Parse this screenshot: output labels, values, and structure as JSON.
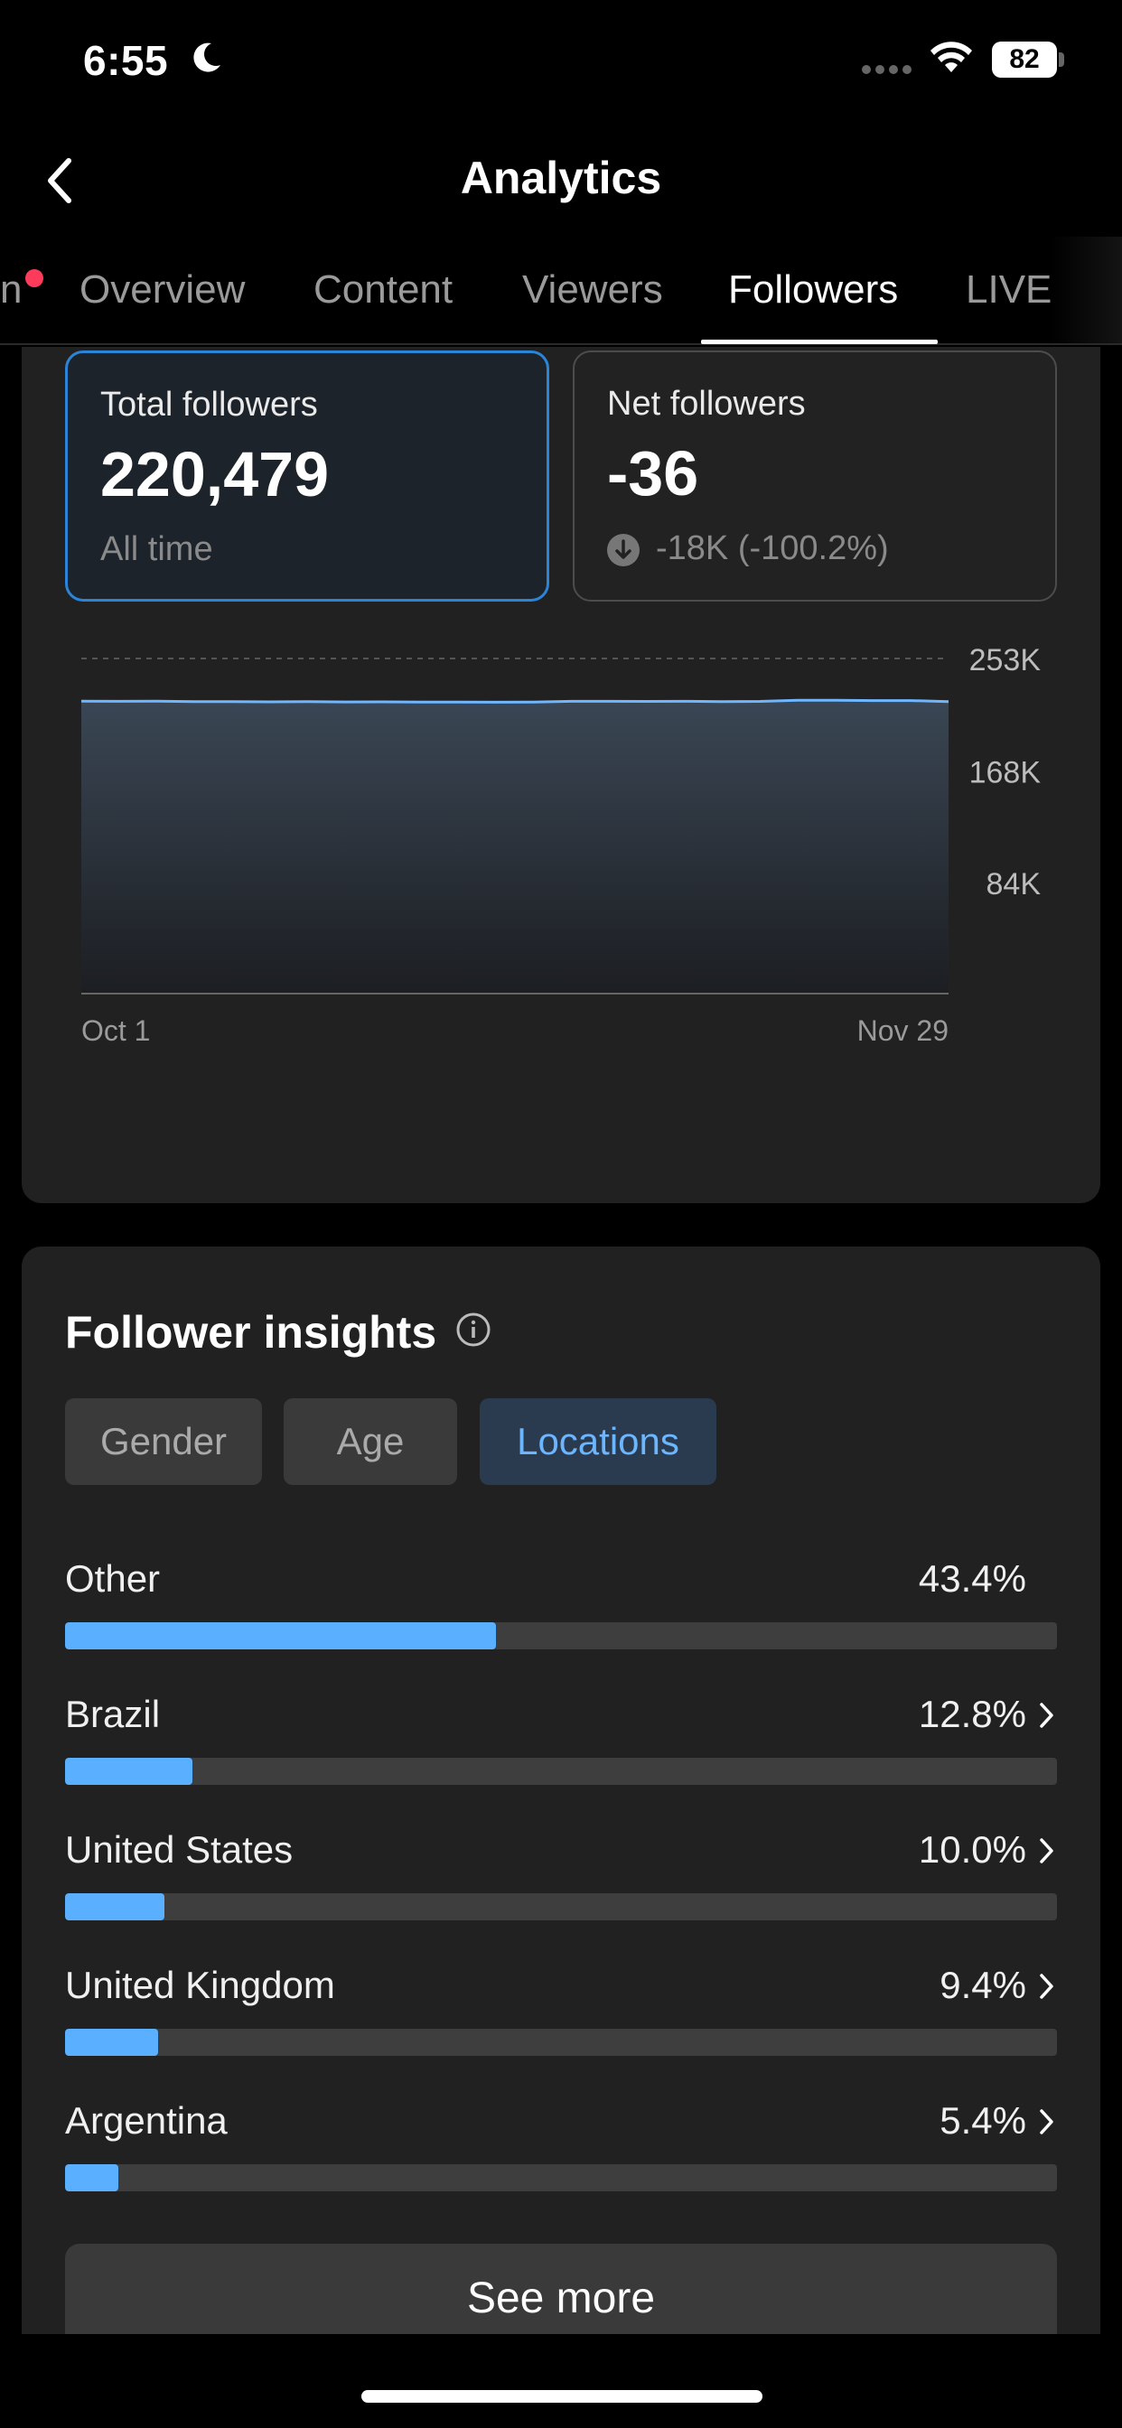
{
  "status": {
    "time": "6:55",
    "battery": "82"
  },
  "header": {
    "title": "Analytics"
  },
  "tabs": [
    {
      "label": "n"
    },
    {
      "label": "Overview"
    },
    {
      "label": "Content"
    },
    {
      "label": "Viewers"
    },
    {
      "label": "Followers",
      "active": true
    },
    {
      "label": "LIVE"
    }
  ],
  "stats": {
    "total": {
      "label": "Total followers",
      "value": "220,479",
      "sub": "All time"
    },
    "net": {
      "label": "Net followers",
      "value": "-36",
      "change": "-18K (-100.2%)"
    }
  },
  "chart_data": {
    "type": "area",
    "x_labels": [
      "Oct 1",
      "Nov 29"
    ],
    "y_ticks": [
      "253K",
      "168K",
      "84K"
    ],
    "ylim": [
      0,
      253000
    ],
    "values": [
      220800,
      220700,
      220800,
      220500,
      220500,
      220300,
      220400,
      220200,
      220300,
      220100,
      220100,
      220000,
      220100,
      220700,
      220700,
      220600,
      220700,
      220500,
      220600,
      221500,
      221500,
      221200,
      221200,
      220479
    ],
    "grid": true,
    "accent": "#6fb6ff"
  },
  "insights": {
    "title": "Follower insights",
    "chips": [
      "Gender",
      "Age",
      "Locations"
    ],
    "active_chip": "Locations",
    "locations": [
      {
        "name": "Other",
        "pct": "43.4%",
        "value": 43.4,
        "arrow": false
      },
      {
        "name": "Brazil",
        "pct": "12.8%",
        "value": 12.8,
        "arrow": true
      },
      {
        "name": "United States",
        "pct": "10.0%",
        "value": 10.0,
        "arrow": true
      },
      {
        "name": "United Kingdom",
        "pct": "9.4%",
        "value": 9.4,
        "arrow": true
      },
      {
        "name": "Argentina",
        "pct": "5.4%",
        "value": 5.4,
        "arrow": true
      }
    ],
    "see_more": "See more"
  }
}
